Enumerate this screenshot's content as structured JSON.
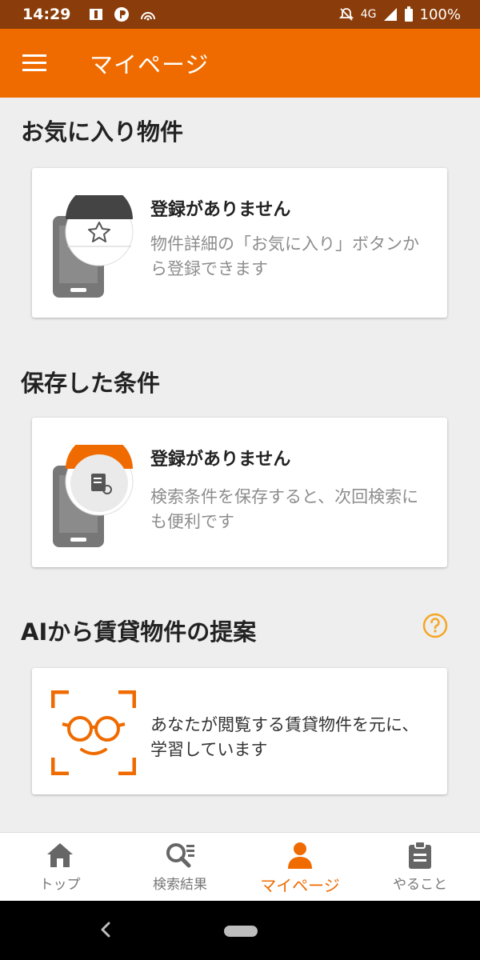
{
  "status_bar": {
    "time": "14:29",
    "network": "4G",
    "battery": "100%"
  },
  "app_bar": {
    "title": "マイページ"
  },
  "favorites": {
    "title": "お気に入り物件",
    "empty_heading": "登録がありません",
    "empty_text": "物件詳細の「お気に入り」ボタンから登録できます"
  },
  "saved_conditions": {
    "title": "保存した条件",
    "empty_heading": "登録がありません",
    "empty_text": "検索条件を保存すると、次回検索にも便利です"
  },
  "ai": {
    "title": "AIから賃貸物件の提案",
    "text": "あなたが閲覧する賃貸物件を元に、学習しています"
  },
  "bottom_nav": [
    {
      "label": "トップ",
      "icon": "home-icon"
    },
    {
      "label": "検索結果",
      "icon": "search-results-icon"
    },
    {
      "label": "マイページ",
      "icon": "person-icon"
    },
    {
      "label": "やること",
      "icon": "clipboard-icon"
    }
  ],
  "colors": {
    "accent": "#ef6b00",
    "status_bar": "#8a3d0a",
    "background": "#eeeeee"
  }
}
